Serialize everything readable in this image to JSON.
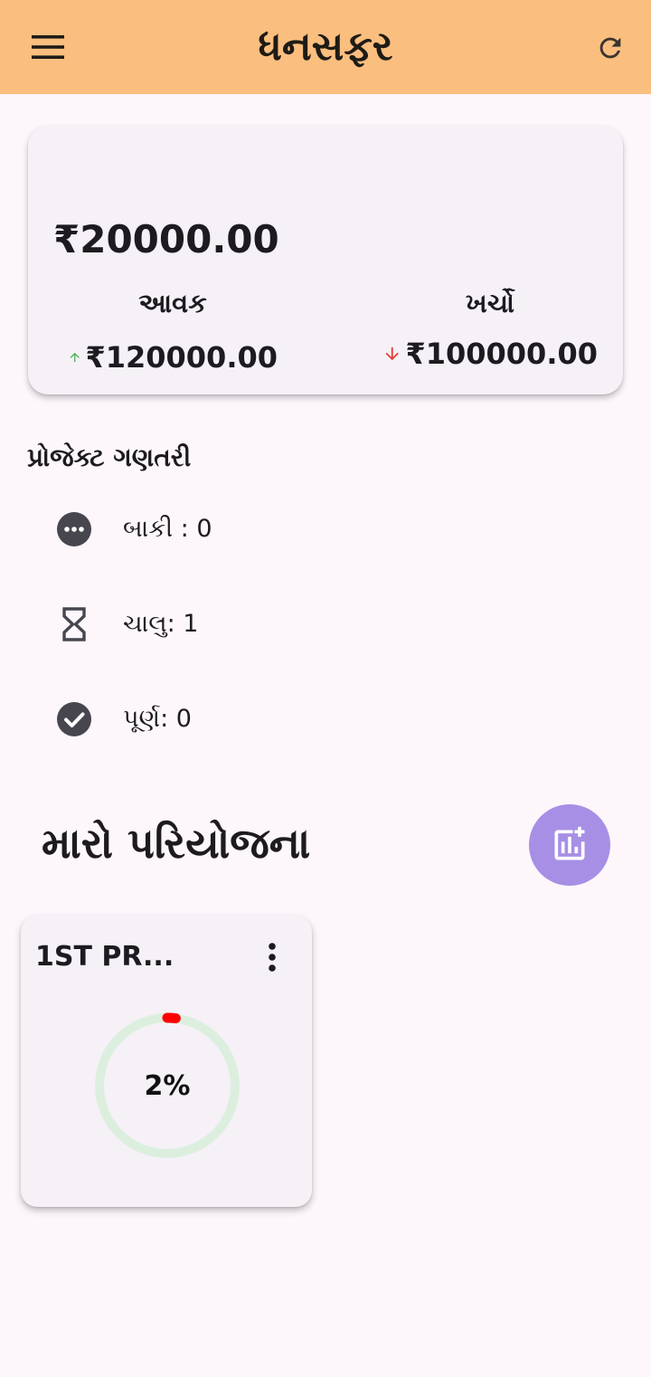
{
  "app": {
    "title": "ધનસફર",
    "header_color": "#fabe7f",
    "menu_icon": "menu-icon",
    "refresh_icon": "refresh-icon"
  },
  "summary": {
    "balance": "₹20000.00",
    "income": {
      "label": "આવક",
      "amount": "₹120000.00",
      "icon": "arrow-up-icon",
      "color": "#4caf50"
    },
    "expense": {
      "label": "ખર્ચો",
      "amount": "₹100000.00",
      "icon": "arrow-down-icon",
      "color": "#e53935"
    }
  },
  "project_count": {
    "heading": "પ્રોજેક્ટ ગણતરી",
    "items": [
      {
        "icon": "more-horizontal-circle-icon",
        "text": "બાકી : 0"
      },
      {
        "icon": "hourglass-icon",
        "text": "ચાલુ: 1"
      },
      {
        "icon": "check-circle-icon",
        "text": "પૂર્ણ: 0"
      }
    ]
  },
  "projects": {
    "heading": "મારો પરિયોજના",
    "add_button_icon": "add-chart-icon",
    "add_button_color": "#a78fe5",
    "list": [
      {
        "name": "1ST PR...",
        "progress": 0.02,
        "progress_label": "2%",
        "menu_icon": "more-vertical-icon",
        "progress_color": "#ff0000",
        "track_color": "#dcefdf"
      }
    ]
  }
}
